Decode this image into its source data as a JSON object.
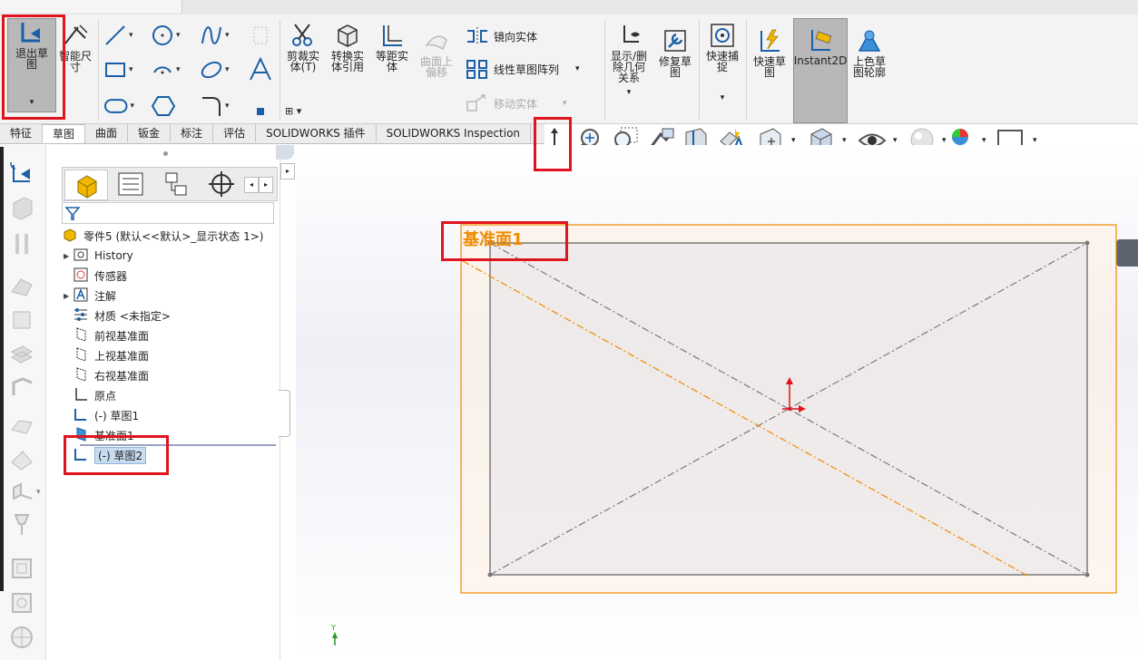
{
  "ribbon": {
    "exit_sketch": "退出草图",
    "smart_dim": "智能尺寸",
    "trim": "剪裁实体(T)",
    "convert": "转换实体引用",
    "offset": "等距实体",
    "surface_offset": "曲面上偏移",
    "mirror": "镜向实体",
    "linear_pattern": "线性草图阵列",
    "move": "移动实体",
    "show_relations": "显示/删除几何关系",
    "repair": "修复草图",
    "quick_snap": "快速捕捉",
    "rapid_sketch": "快速草图",
    "instant2d": "Instant2D",
    "shaded": "上色草图轮廓"
  },
  "tabs": [
    "特征",
    "草图",
    "曲面",
    "钣金",
    "标注",
    "评估",
    "SOLIDWORKS 插件",
    "SOLIDWORKS Inspection"
  ],
  "active_tab": "草图",
  "tree": {
    "root": "零件5 (默认<<默认>_显示状态 1>)",
    "items": [
      "History",
      "传感器",
      "注解",
      "材质 <未指定>",
      "前视基准面",
      "上视基准面",
      "右视基准面",
      "原点",
      "(-) 草图1",
      "基准面1",
      "(-) 草图2"
    ]
  },
  "viewport": {
    "plane_label": "基准面1",
    "axis_y": "Y"
  },
  "colors": {
    "highlight": "#e0141e",
    "plane_edge": "#f08a00",
    "sketch_line": "#7a7a7a"
  }
}
